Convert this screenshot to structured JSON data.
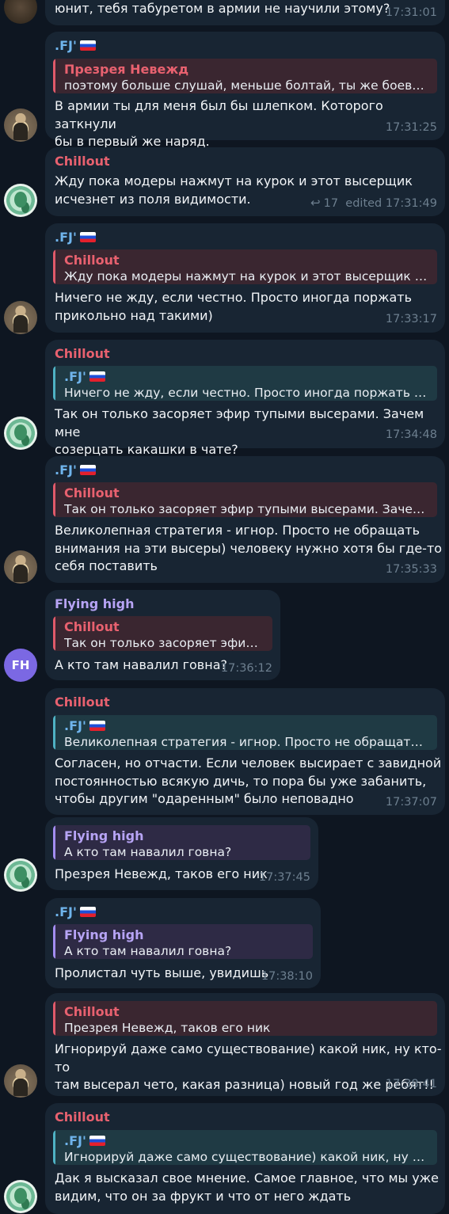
{
  "colors": {
    "background": "#0e1621",
    "bubble": "#182533",
    "name_red": "#e8616f",
    "name_blue": "#6fb4ec",
    "name_purple": "#b7a4f5",
    "timestamp": "#6d7f8f"
  },
  "icons": {
    "flag": "russia-flag-icon",
    "reply": "reply-arrow-icon"
  },
  "messages": [
    {
      "text": "юнит, тебя табуретом в армии не научили этому?",
      "time": "17:31:01"
    },
    {
      "sender": ".FJ'",
      "quote_name": "Презрея Невежд",
      "quote_text": "поэтому больше слушай, меньше болтай, ты же боевой юнит",
      "text": "В армии ты для меня был бы шлепком. Которого заткнули\nбы в первый же наряд.",
      "time": "17:31:25"
    },
    {
      "sender": "Chillout",
      "text": "Жду пока модеры нажмут на курок и этот высерщик\nисчезнет из поля видимости.",
      "replies": "17",
      "edited": "edited",
      "time": "17:31:49"
    },
    {
      "sender": ".FJ'",
      "quote_name": "Chillout",
      "quote_text": "Жду пока модеры нажмут на курок и этот высерщик исчезнет",
      "text": "Ничего не жду, если честно. Просто иногда поржать\nприкольно над такими)",
      "time": "17:33:17"
    },
    {
      "sender": "Chillout",
      "quote_name": ".FJ'",
      "quote_text": "Ничего не жду, если честно. Просто иногда поржать прикольно",
      "text": "Так он только засоряет эфир тупыми высерами. Зачем мне\nсозерцать какашки в чате?",
      "time": "17:34:48"
    },
    {
      "sender": ".FJ'",
      "quote_name": "Chillout",
      "quote_text": "Так он только засоряет эфир тупыми высерами. Зачем мне",
      "text": "Великолепная стратегия - игнор. Просто не обращать\nвнимания на эти высеры) человеку нужно хотя бы где-то\nсебя поставить",
      "time": "17:35:33"
    },
    {
      "sender": "Flying high",
      "avatar_initials": "FH",
      "quote_name": "Chillout",
      "quote_text": "Так он только засоряет эфир тупыми",
      "text": "А кто там навалил говна?",
      "time": "17:36:12"
    },
    {
      "sender": "Chillout",
      "quote_name": ".FJ'",
      "quote_text": "Великолепная стратегия - игнор. Просто не обращать внимания",
      "text": "Согласен, но отчасти. Если человек высирает с завидной\nпостоянностью всякую дичь, то пора бы уже забанить,\nчтобы другим \"одаренным\" было неповадно",
      "time": "17:37:07"
    },
    {
      "quote_name": "Flying high",
      "quote_text": "А кто там навалил говна?",
      "text": "Презрея Невежд, таков его ник",
      "time": "17:37:45"
    },
    {
      "sender": ".FJ'",
      "quote_name": "Flying high",
      "quote_text": "А кто там навалил говна?",
      "text": "Пролистал чуть выше, увидишь",
      "time": "17:38:10"
    },
    {
      "quote_name": "Chillout",
      "quote_text": "Презрея Невежд, таков его ник",
      "text": "Игнорируй даже само существование) какой ник, ну кто-то\nтам высерал чето, какая разница) новый год же ребят!!",
      "time": "17:38:41"
    },
    {
      "sender": "Chillout",
      "quote_name": ".FJ'",
      "quote_text": "Игнорируй даже само существование) какой ник, ну кто-то там",
      "text": "Дак я высказал свое мнение. Самое главное, что мы уже\nвидим, что он за фрукт и что от него ждать"
    }
  ]
}
